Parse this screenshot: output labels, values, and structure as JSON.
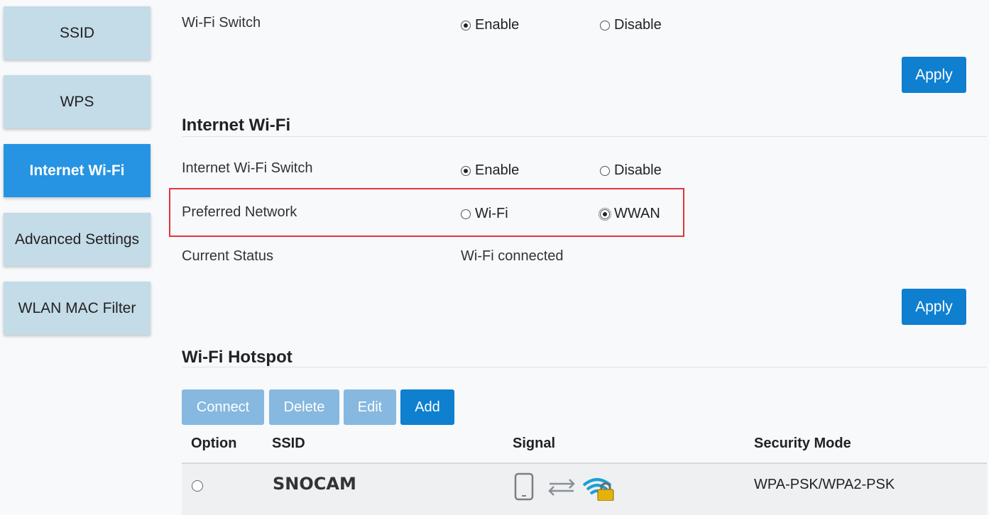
{
  "sidebar": {
    "items": [
      {
        "label": "SSID",
        "active": false
      },
      {
        "label": "WPS",
        "active": false
      },
      {
        "label": "Internet Wi-Fi",
        "active": true
      },
      {
        "label": "Advanced Settings",
        "active": false
      },
      {
        "label": "WLAN MAC Filter",
        "active": false
      }
    ]
  },
  "wifi_switch": {
    "label": "Wi-Fi Switch",
    "enable_label": "Enable",
    "disable_label": "Disable",
    "selected": "Enable",
    "apply_label": "Apply"
  },
  "internet_wifi": {
    "title": "Internet Wi-Fi",
    "switch_label": "Internet Wi-Fi Switch",
    "enable_label": "Enable",
    "disable_label": "Disable",
    "switch_selected": "Enable",
    "preferred_label": "Preferred Network",
    "preferred_options": [
      "Wi-Fi",
      "WWAN"
    ],
    "preferred_selected": "WWAN",
    "status_label": "Current Status",
    "status_value": "Wi-Fi connected",
    "apply_label": "Apply"
  },
  "hotspot": {
    "title": "Wi-Fi Hotspot",
    "buttons": {
      "connect": "Connect",
      "delete": "Delete",
      "edit": "Edit",
      "add": "Add"
    },
    "columns": [
      "Option",
      "SSID",
      "Signal",
      "Security Mode"
    ],
    "rows": [
      {
        "ssid": "SNOCAM",
        "security": "WPA-PSK/WPA2-PSK",
        "selected": false
      }
    ]
  },
  "colors": {
    "accent": "#0f7fd0",
    "accent_disabled": "#86b8e0",
    "sidebar_active": "#2694e3",
    "sidebar_bg": "#c4dbe8",
    "highlight": "#e0353c",
    "wifi_icon": "#1a9fd6",
    "lock_icon": "#e5b20c"
  }
}
